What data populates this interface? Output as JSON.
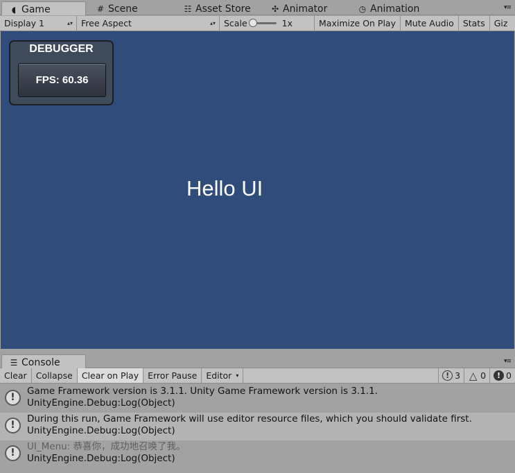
{
  "game_tabs": [
    {
      "label": "Game",
      "icon": "pacman-icon",
      "glyph": "◖"
    },
    {
      "label": "Scene",
      "icon": "grid-icon",
      "glyph": "#"
    },
    {
      "label": "Asset Store",
      "icon": "bag-icon",
      "glyph": "☷"
    },
    {
      "label": "Animator",
      "icon": "animator-icon",
      "glyph": "✣"
    },
    {
      "label": "Animation",
      "icon": "clock-icon",
      "glyph": "◷"
    }
  ],
  "game_toolbar": {
    "display": "Display 1",
    "aspect": "Free Aspect",
    "scale_label": "Scale",
    "scale_value": "1x",
    "maximize": "Maximize On Play",
    "mute": "Mute Audio",
    "stats": "Stats",
    "gizmos": "Giz"
  },
  "debugger": {
    "title": "DEBUGGER",
    "fps": "FPS: 60.36"
  },
  "game_view": {
    "text": "Hello UI",
    "background": "#2f4c7a"
  },
  "console_tab": {
    "label": "Console",
    "icon": "console-icon",
    "glyph": "☰"
  },
  "console_toolbar": {
    "clear": "Clear",
    "collapse": "Collapse",
    "clear_on_play": "Clear on Play",
    "error_pause": "Error Pause",
    "editor": "Editor",
    "info_count": "3",
    "warning_count": "0",
    "error_count": "0"
  },
  "log_entries": [
    {
      "line1": "Game Framework version is 3.1.1. Unity Game Framework version is 3.1.1.",
      "line2": "UnityEngine.Debug:Log(Object)"
    },
    {
      "line1": "During this run, Game Framework will use editor resource files, which you should validate first.",
      "line2": "UnityEngine.Debug:Log(Object)"
    },
    {
      "line1": "UI_Menu: 恭喜你，成功地召唤了我。",
      "line2": "UnityEngine.Debug:Log(Object)"
    }
  ]
}
